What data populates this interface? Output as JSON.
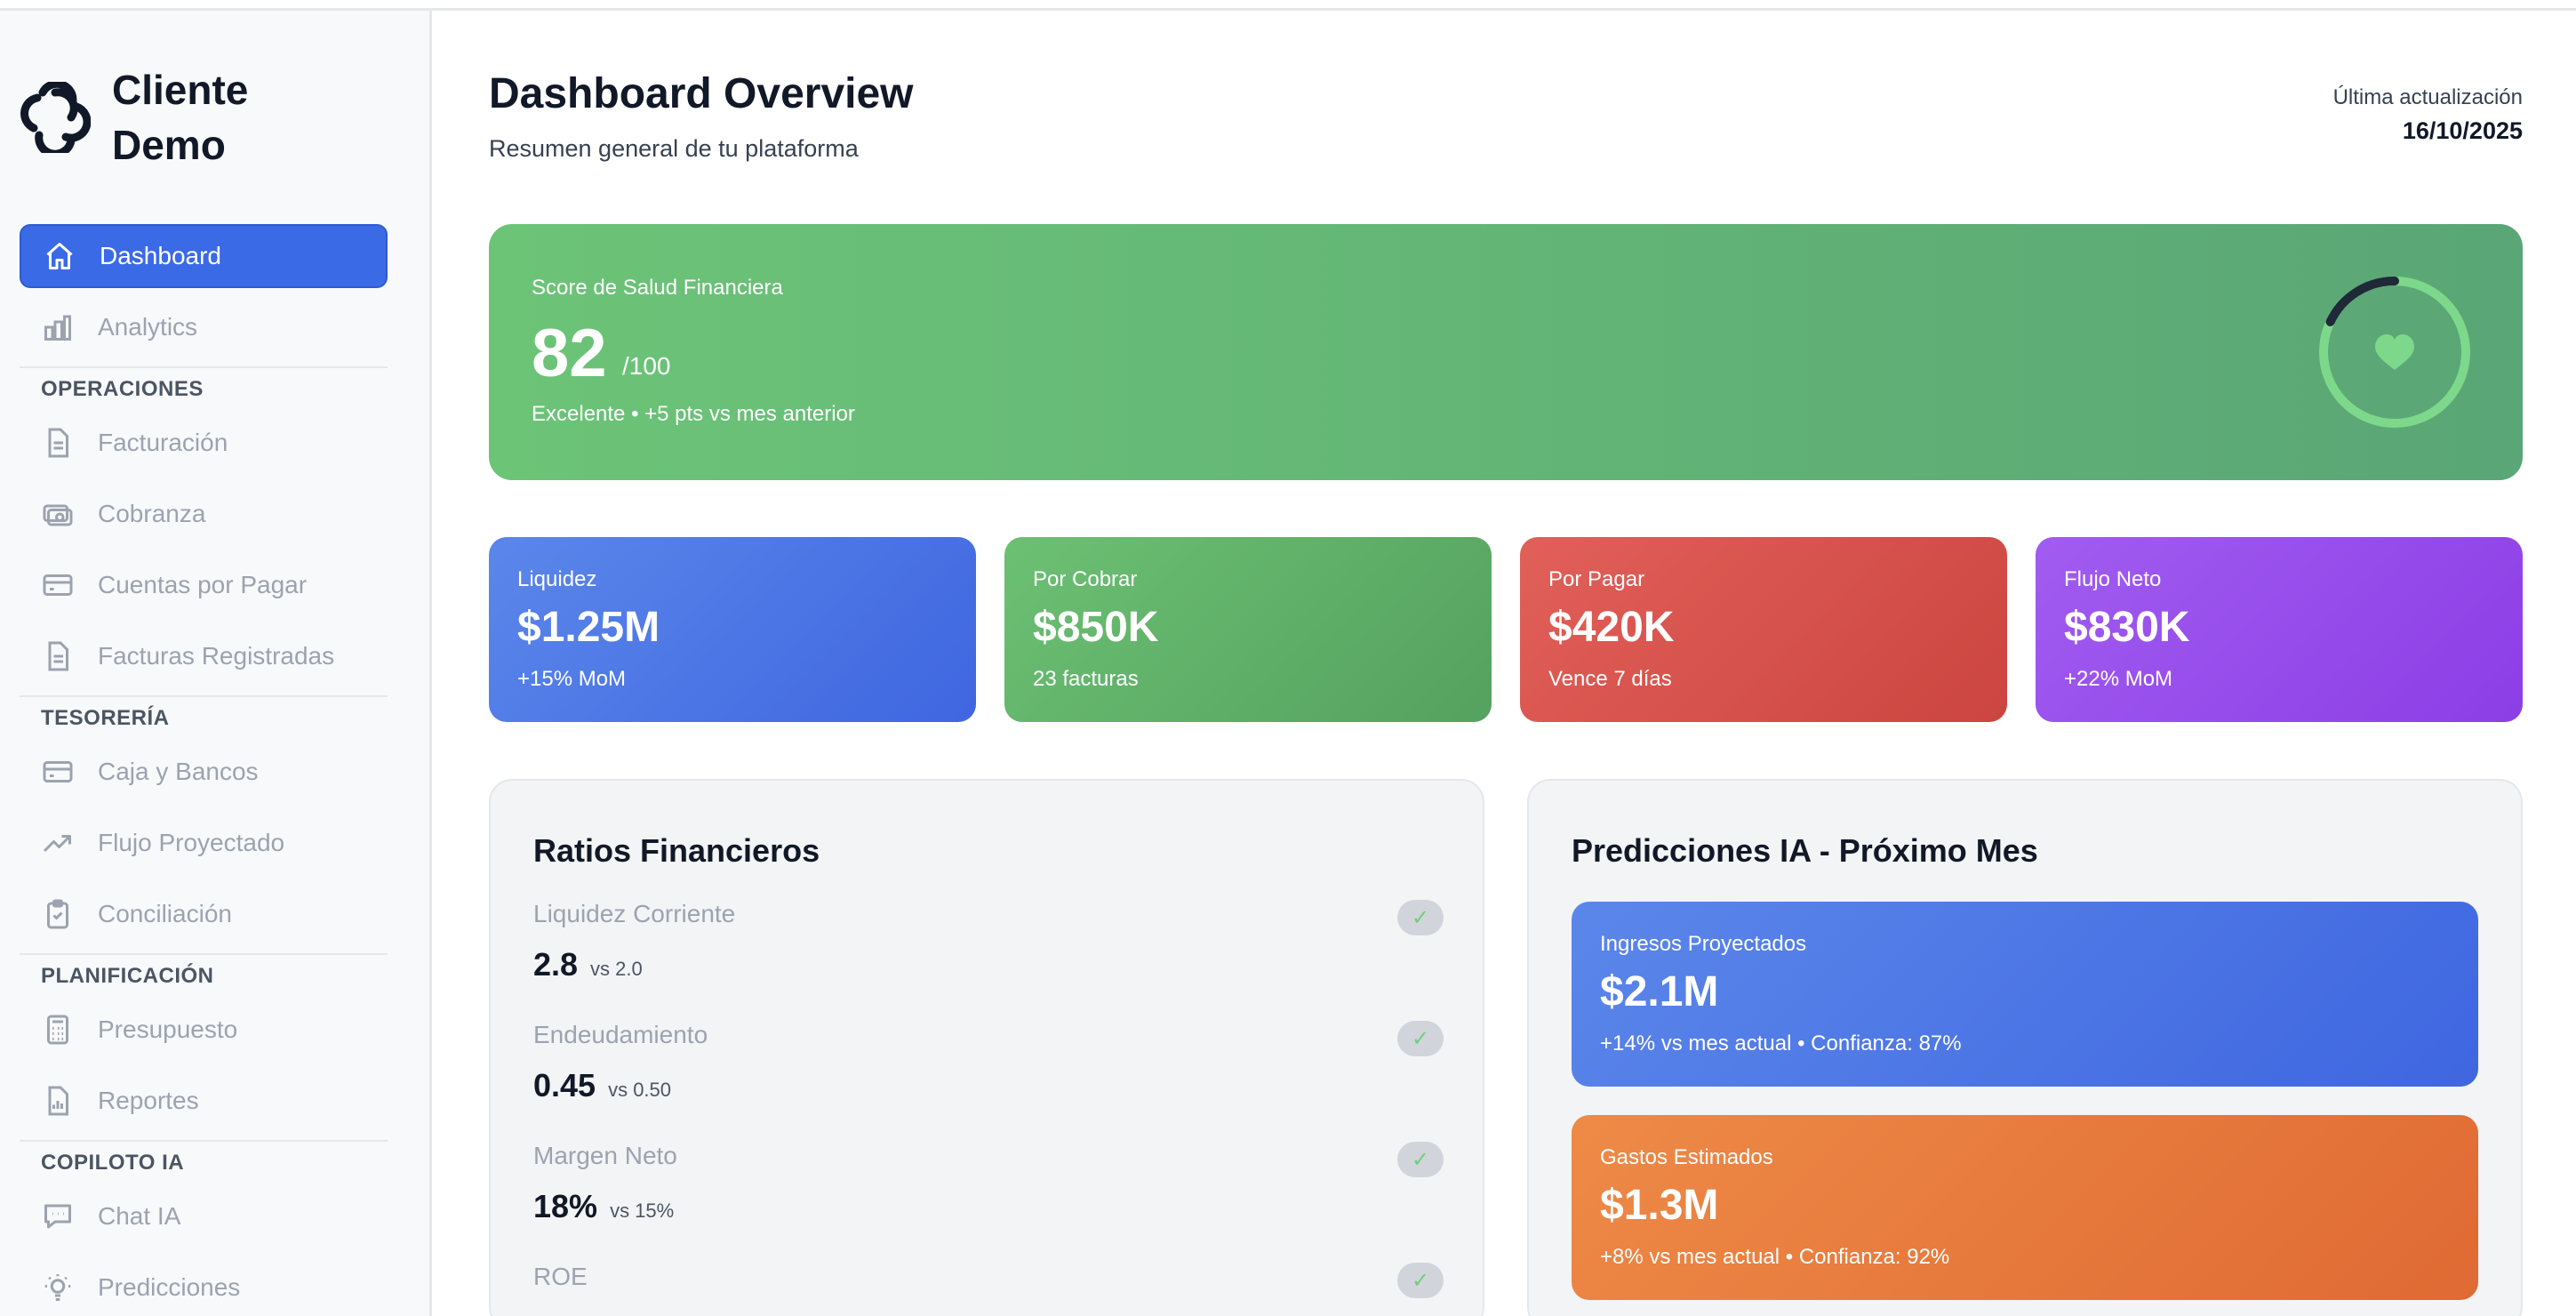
{
  "app": {
    "name": "Cliente Demo"
  },
  "sidebar": {
    "top_items": [
      {
        "label": "Dashboard",
        "icon": "home-icon",
        "active": true
      },
      {
        "label": "Analytics",
        "icon": "bar-chart-icon"
      }
    ],
    "sections": [
      {
        "title": "OPERACIONES",
        "items": [
          {
            "label": "Facturación",
            "icon": "document-icon"
          },
          {
            "label": "Cobranza",
            "icon": "cash-icon"
          },
          {
            "label": "Cuentas por Pagar",
            "icon": "credit-card-icon"
          },
          {
            "label": "Facturas Registradas",
            "icon": "document-icon"
          }
        ]
      },
      {
        "title": "TESORERÍA",
        "items": [
          {
            "label": "Caja y Bancos",
            "icon": "credit-card-icon"
          },
          {
            "label": "Flujo Proyectado",
            "icon": "trend-up-icon"
          },
          {
            "label": "Conciliación",
            "icon": "clipboard-check-icon"
          }
        ]
      },
      {
        "title": "PLANIFICACIÓN",
        "items": [
          {
            "label": "Presupuesto",
            "icon": "calculator-icon"
          },
          {
            "label": "Reportes",
            "icon": "report-icon"
          }
        ]
      },
      {
        "title": "COPILOTO IA",
        "items": [
          {
            "label": "Chat IA",
            "icon": "chat-icon"
          },
          {
            "label": "Predicciones",
            "icon": "lightbulb-icon"
          }
        ]
      }
    ]
  },
  "header": {
    "title": "Dashboard Overview",
    "subtitle": "Resumen general de tu plataforma",
    "update_label": "Última actualización",
    "update_date": "16/10/2025"
  },
  "score": {
    "label": "Score de Salud Financiera",
    "value": "82",
    "max": "/100",
    "note": "Excelente • +5 pts vs mes anterior",
    "fraction": 0.18,
    "ring_icon": "heart-icon"
  },
  "kpis": [
    {
      "label": "Liquidez",
      "value": "$1.25M",
      "sub": "+15% MoM"
    },
    {
      "label": "Por Cobrar",
      "value": "$850K",
      "sub": "23 facturas"
    },
    {
      "label": "Por Pagar",
      "value": "$420K",
      "sub": "Vence 7 días"
    },
    {
      "label": "Flujo Neto",
      "value": "$830K",
      "sub": "+22% MoM"
    }
  ],
  "ratios": {
    "title": "Ratios Financieros",
    "items": [
      {
        "name": "Liquidez Corriente",
        "value": "2.8",
        "bench": "vs 2.0",
        "check": "✓"
      },
      {
        "name": "Endeudamiento",
        "value": "0.45",
        "bench": "vs 0.50",
        "check": "✓"
      },
      {
        "name": "Margen Neto",
        "value": "18%",
        "bench": "vs 15%",
        "check": "✓"
      },
      {
        "name": "ROE",
        "value": "",
        "bench": "",
        "check": "✓"
      }
    ]
  },
  "predictions": {
    "title": "Predicciones IA - Próximo Mes",
    "items": [
      {
        "label": "Ingresos Proyectados",
        "value": "$2.1M",
        "sub": "+14% vs mes actual • Confianza: 87%"
      },
      {
        "label": "Gastos Estimados",
        "value": "$1.3M",
        "sub": "+8% vs mes actual • Confianza: 92%"
      }
    ]
  },
  "colors": {
    "accent": "#3b6ae6",
    "green": "#6cc477",
    "red": "#e16059",
    "purple": "#a15cf0",
    "orange": "#ee8a47"
  }
}
